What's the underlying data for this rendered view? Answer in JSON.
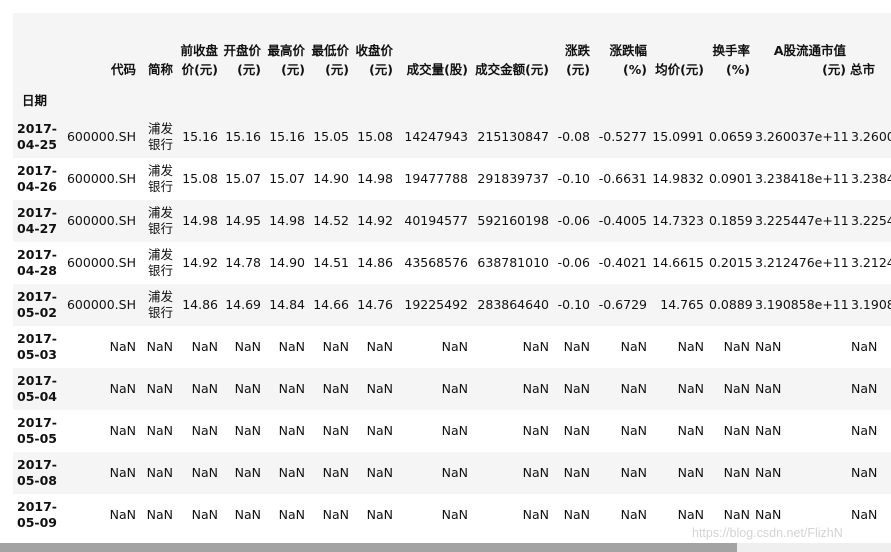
{
  "table": {
    "index_name": "日期",
    "columns": [
      {
        "label": "代码"
      },
      {
        "label": "简称"
      },
      {
        "label": "前收盘价(元)"
      },
      {
        "label": "开盘价(元)"
      },
      {
        "label": "最高价(元)"
      },
      {
        "label": "最低价(元)"
      },
      {
        "label": "收盘价(元)"
      },
      {
        "label": "成交量(股)"
      },
      {
        "label": "成交金额(元)"
      },
      {
        "label": "涨跌(元)"
      },
      {
        "label": "涨跌幅(%)"
      },
      {
        "label": "均价(元)"
      },
      {
        "label": "换手率(%)"
      },
      {
        "label": "A股流通市值(元)"
      },
      {
        "label": "总市"
      }
    ],
    "rows": [
      {
        "date": "2017-04-25",
        "cells": [
          "600000.SH",
          "浦发银行",
          "15.16",
          "15.16",
          "15.16",
          "15.05",
          "15.08",
          "14247943",
          "215130847",
          "-0.08",
          "-0.5277",
          "15.0991",
          "0.0659",
          "3.260037e+11",
          "3.2600"
        ]
      },
      {
        "date": "2017-04-26",
        "cells": [
          "600000.SH",
          "浦发银行",
          "15.08",
          "15.07",
          "15.07",
          "14.90",
          "14.98",
          "19477788",
          "291839737",
          "-0.10",
          "-0.6631",
          "14.9832",
          "0.0901",
          "3.238418e+11",
          "3.2384"
        ]
      },
      {
        "date": "2017-04-27",
        "cells": [
          "600000.SH",
          "浦发银行",
          "14.98",
          "14.95",
          "14.98",
          "14.52",
          "14.92",
          "40194577",
          "592160198",
          "-0.06",
          "-0.4005",
          "14.7323",
          "0.1859",
          "3.225447e+11",
          "3.2254"
        ]
      },
      {
        "date": "2017-04-28",
        "cells": [
          "600000.SH",
          "浦发银行",
          "14.92",
          "14.78",
          "14.90",
          "14.51",
          "14.86",
          "43568576",
          "638781010",
          "-0.06",
          "-0.4021",
          "14.6615",
          "0.2015",
          "3.212476e+11",
          "3.2124"
        ]
      },
      {
        "date": "2017-05-02",
        "cells": [
          "600000.SH",
          "浦发银行",
          "14.86",
          "14.69",
          "14.84",
          "14.66",
          "14.76",
          "19225492",
          "283864640",
          "-0.10",
          "-0.6729",
          "14.765",
          "0.0889",
          "3.190858e+11",
          "3.1908"
        ]
      },
      {
        "date": "2017-05-03",
        "cells": [
          "NaN",
          "NaN",
          "NaN",
          "NaN",
          "NaN",
          "NaN",
          "NaN",
          "NaN",
          "NaN",
          "NaN",
          "NaN",
          "NaN",
          "NaN",
          "NaN",
          "NaN"
        ]
      },
      {
        "date": "2017-05-04",
        "cells": [
          "NaN",
          "NaN",
          "NaN",
          "NaN",
          "NaN",
          "NaN",
          "NaN",
          "NaN",
          "NaN",
          "NaN",
          "NaN",
          "NaN",
          "NaN",
          "NaN",
          "NaN"
        ]
      },
      {
        "date": "2017-05-05",
        "cells": [
          "NaN",
          "NaN",
          "NaN",
          "NaN",
          "NaN",
          "NaN",
          "NaN",
          "NaN",
          "NaN",
          "NaN",
          "NaN",
          "NaN",
          "NaN",
          "NaN",
          "NaN"
        ]
      },
      {
        "date": "2017-05-08",
        "cells": [
          "NaN",
          "NaN",
          "NaN",
          "NaN",
          "NaN",
          "NaN",
          "NaN",
          "NaN",
          "NaN",
          "NaN",
          "NaN",
          "NaN",
          "NaN",
          "NaN",
          "NaN"
        ]
      },
      {
        "date": "2017-05-09",
        "cells": [
          "NaN",
          "NaN",
          "NaN",
          "NaN",
          "NaN",
          "NaN",
          "NaN",
          "NaN",
          "NaN",
          "NaN",
          "NaN",
          "NaN",
          "NaN",
          "NaN",
          "NaN"
        ]
      }
    ]
  },
  "watermark": "https://blog.csdn.net/FlizhN"
}
